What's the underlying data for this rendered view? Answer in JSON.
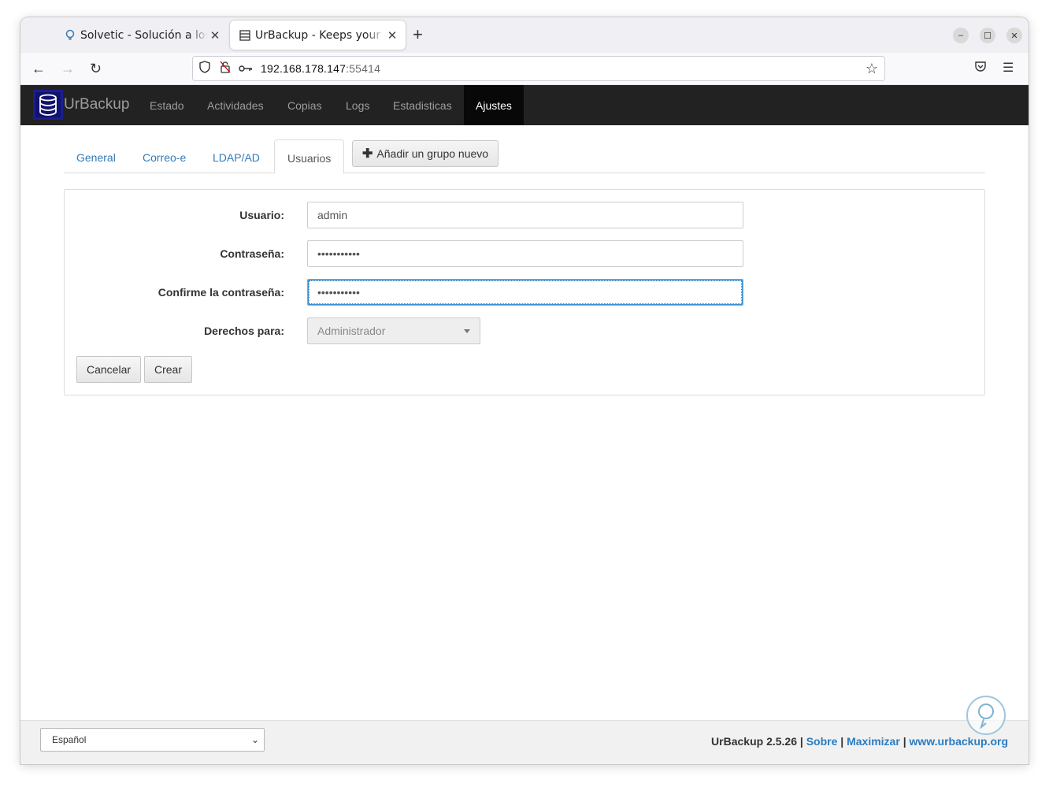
{
  "browser": {
    "tabs": [
      {
        "title": "Solvetic - Solución a los pr",
        "icon": "lightbulb-icon",
        "active": false
      },
      {
        "title": "UrBackup - Keeps your da",
        "icon": "database-icon",
        "active": true
      }
    ],
    "url": {
      "host": "192.168.178.147",
      "port": ":55414"
    }
  },
  "app": {
    "brand": "UrBackup",
    "menu": [
      "Estado",
      "Actividades",
      "Copias",
      "Logs",
      "Estadisticas",
      "Ajustes"
    ],
    "active_menu": "Ajustes"
  },
  "settings": {
    "tabs": [
      "General",
      "Correo-e",
      "LDAP/AD",
      "Usuarios"
    ],
    "active_tab": "Usuarios",
    "add_group_label": "Añadir un grupo nuevo"
  },
  "form": {
    "user_label": "Usuario:",
    "user_value": "admin",
    "password_label": "Contraseña:",
    "password_value": "•••••••••••",
    "confirm_label": "Confirme la contraseña:",
    "confirm_value": "•••••••••••",
    "rights_label": "Derechos para:",
    "rights_value": "Administrador",
    "cancel_label": "Cancelar",
    "create_label": "Crear"
  },
  "footer": {
    "language": "Español",
    "version": "UrBackup 2.5.26",
    "sep": "|",
    "about": "Sobre",
    "maximize": "Maximizar",
    "website": "www.urbackup.org"
  }
}
